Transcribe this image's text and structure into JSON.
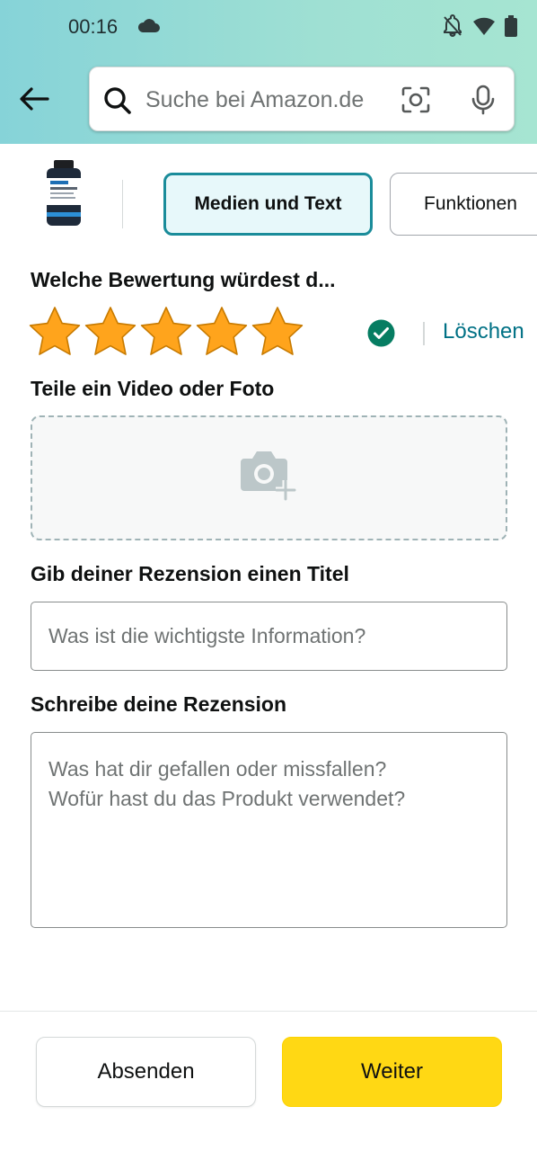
{
  "status_bar": {
    "time": "00:16",
    "icons": [
      "cloud-icon",
      "notifications-off-icon",
      "wifi-icon",
      "battery-icon"
    ]
  },
  "search": {
    "placeholder": "Suche bei Amazon.de",
    "icons": [
      "back-arrow-icon",
      "search-icon",
      "lens-camera-icon",
      "microphone-icon"
    ]
  },
  "tabs": [
    {
      "label": "Medien und Text",
      "selected": true
    },
    {
      "label": "Funktionen",
      "selected": false
    }
  ],
  "rating": {
    "label": "Welche Bewertung würdest d...",
    "stars": 5,
    "max_stars": 5,
    "delete_label": "Löschen"
  },
  "upload": {
    "label": "Teile ein Video oder Foto",
    "icon": "add-photo-icon"
  },
  "title_field": {
    "label": "Gib deiner Rezension einen Titel",
    "placeholder": "Was ist die wichtigste Information?",
    "value": ""
  },
  "review_field": {
    "label": "Schreibe deine Rezension",
    "placeholder": "Was hat dir gefallen oder missfallen?\nWofür hast du das Produkt verwendet?",
    "value": ""
  },
  "footer": {
    "submit_label": "Absenden",
    "next_label": "Weiter"
  },
  "colors": {
    "header_gradient_start": "#86d3d8",
    "header_gradient_end": "#a6e5d2",
    "star": "#ffa41c",
    "link": "#007185",
    "check": "#067d62",
    "tab_selected_border": "#1a8c9a",
    "next_button": "#ffd814"
  }
}
